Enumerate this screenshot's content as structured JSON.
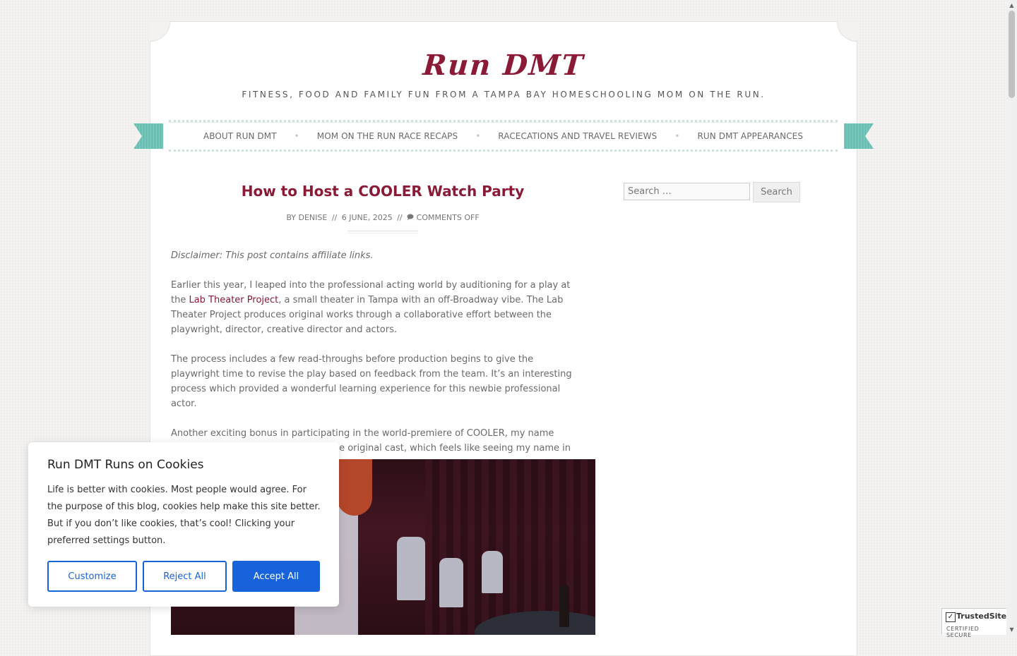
{
  "site": {
    "title": "Run DMT",
    "tagline": "FITNESS, FOOD AND FAMILY FUN FROM A TAMPA BAY HOMESCHOOLING MOM ON THE RUN."
  },
  "nav": {
    "items": [
      {
        "label": "ABOUT RUN DMT"
      },
      {
        "label": "MOM ON THE RUN RACE RECAPS"
      },
      {
        "label": "RACECATIONS AND TRAVEL REVIEWS"
      },
      {
        "label": "RUN DMT APPEARANCES"
      }
    ],
    "separator": "•"
  },
  "post": {
    "title": "How to Host a COOLER Watch Party",
    "meta": {
      "by": "BY",
      "author": "DENISE",
      "sep": "//",
      "date": "6 JUNE, 2025",
      "comments": "COMMENTS OFF"
    },
    "disclaimer": "Disclaimer: This post contains affiliate links.",
    "p1_before": "Earlier this year,  I leaped into the professional acting world by auditioning for a play at the ",
    "p1_link": "Lab Theater Project",
    "p1_after": ", a small theater in Tampa with an off-Broadway vibe. The  Lab Theater  Project produces original works through a collaborative effort between the playwright, director, creative director and actors.",
    "p2": "The process includes a few read-throughs before production begins to give the playwright time to revise the play based on feedback from the team.  It’s an interesting process which provided a wonderful learning experience for this newbie professional actor.",
    "p3": "Another exciting bonus in participating in the world-premiere of COOLER, my name appears in the published script as the original cast, which feels like seeing my name in lights!"
  },
  "sidebar": {
    "search_placeholder": "Search …",
    "search_button": "Search"
  },
  "cookie": {
    "title": "Run  DMT  Runs on Cookies",
    "body": "Life is better with cookies.  Most people would agree.  For the purpose of this blog, cookies help make this site better.  But if you don’t like cookies, that’s cool! Clicking your preferred settings button.",
    "customize": "Customize",
    "reject": "Reject All",
    "accept": "Accept All"
  },
  "trusted": {
    "name": "TrustedSite",
    "sub": "CERTIFIED SECURE"
  },
  "colors": {
    "brand": "#8a1a36",
    "ribbon": "#6cbdb2",
    "cookie_button": "#1863dc"
  }
}
